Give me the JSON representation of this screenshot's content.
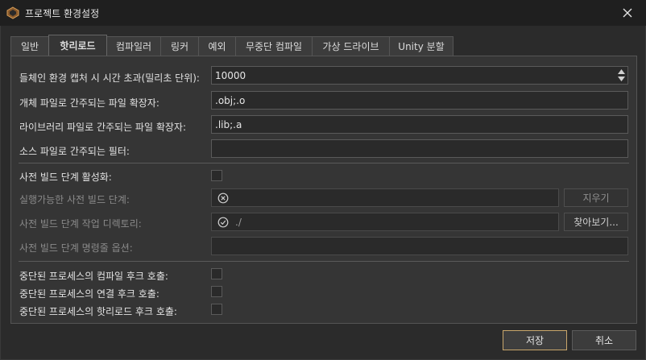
{
  "window": {
    "title": "프로젝트 환경설정",
    "icon": "app-logo-icon",
    "close_icon": "close-icon"
  },
  "tabs": [
    {
      "label": "일반",
      "active": false
    },
    {
      "label": "핫리로드",
      "active": true
    },
    {
      "label": "컴파일러",
      "active": false
    },
    {
      "label": "링커",
      "active": false
    },
    {
      "label": "예외",
      "active": false
    },
    {
      "label": "무중단 컴파일",
      "active": false
    },
    {
      "label": "가상 드라이브",
      "active": false
    },
    {
      "label": "Unity 분할",
      "active": false
    }
  ],
  "fields": {
    "env_capture_timeout": {
      "label": "들체인 환경 캡처 시 시간 초과(밀리초 단위):",
      "value": "10000"
    },
    "object_ext": {
      "label": "개체 파일로 간주되는 파일 확장자:",
      "value": ".obj;.o"
    },
    "library_ext": {
      "label": "라이브러리 파일로 간주되는 파일 확장자:",
      "value": ".lib;.a"
    },
    "source_filter": {
      "label": "소스 파일로 간주되는 필터:",
      "value": ""
    }
  },
  "prebuild": {
    "enable_label": "사전 빌드 단계 활성화:",
    "enabled": false,
    "executable_label": "실행가능한 사전 빌드 단계:",
    "executable_value": "",
    "executable_status_icon": "error-circle-icon",
    "clear_label": "지우기",
    "workdir_label": "사전 빌드 단계 작업 디렉토리:",
    "workdir_value": "./",
    "workdir_status_icon": "check-circle-icon",
    "browse_label": "찾아보기...",
    "cmd_label": "사전 빌드 단계 명령줄 옵션:",
    "cmd_value": ""
  },
  "hooks": [
    {
      "label": "중단된 프로세스의 컴파일 후크 호출:",
      "checked": false
    },
    {
      "label": "중단된 프로세스의 연결 후크 호출:",
      "checked": false
    },
    {
      "label": "중단된 프로세스의 핫리로드 후크 호출:",
      "checked": false
    }
  ],
  "footer": {
    "save_label": "저장",
    "cancel_label": "취소"
  },
  "colors": {
    "accent": "#c9a66b",
    "background": "#2b2b2b",
    "panel": "#353535"
  }
}
